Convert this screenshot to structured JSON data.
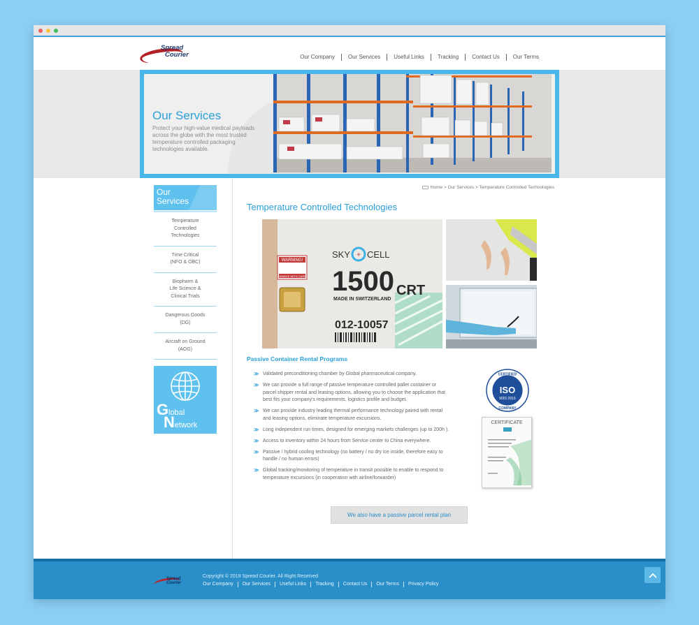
{
  "window": {
    "dots": [
      "#f25f5c",
      "#f9c23c",
      "#3fbf5b"
    ]
  },
  "header": {
    "logo_line1": "Spread",
    "logo_line2": "Courier",
    "nav": [
      "Our Company",
      "Our Services",
      "Useful Links",
      "Tracking",
      "Contact Us",
      "Our Terms"
    ]
  },
  "hero": {
    "title": "Our Services",
    "description": "Protect your high-value medical payloads across the globe with the most trusted temperature controlled packaging technologies available."
  },
  "sidebar": {
    "heading_line1": "Our",
    "heading_line2": "Services",
    "items": [
      {
        "lines": [
          "Temperature",
          "Controlled",
          "Technologies"
        ]
      },
      {
        "lines": [
          "Time Critical",
          "(NFO & OBC)"
        ]
      },
      {
        "lines": [
          "Biopharm &",
          "Life Science &",
          "Clinical Trials"
        ]
      },
      {
        "lines": [
          "Dangerous Goods",
          "(DG)"
        ]
      },
      {
        "lines": [
          "Aircraft on Ground",
          "(AOG)"
        ]
      }
    ],
    "global_network": {
      "g": "G",
      "lobal": "lobal",
      "n": "N",
      "etwork": "etwork"
    }
  },
  "breadcrumb": "Home > Our Services > Temperature Controlled Technologies",
  "main": {
    "title": "Temperature Controlled Technologies",
    "photo": {
      "brand_left": "SKY",
      "brand_right": "CELL",
      "model_number": "1500",
      "model_suffix": "CRT",
      "made_in": "MADE IN SWITZERLAND",
      "serial": "012-10057",
      "warning": "WARNING!",
      "handle_with_care": "HANDLE WITH CARE"
    },
    "section_title": "Passive Container Rental Programs",
    "bullets": [
      "Validated preconditioning chamber by Global pharmaceutical company.",
      "We can provide a full range of passive temperature controlled pallet container or parcel shipper rental and leasing options, allowing you to choose the application that best fits your company's requirements, logistics profile and budget.",
      "We can provide industry leading thermal performance technology paired with rental and leasing options, eliminate temperature excursions.",
      "Long independent run times, designed for emerging markets challenges (up to 200h ).",
      "Access to inventory within 24 hours from Service center to China everywhere.",
      "Passive / hybrid cooling technology (no battery / no dry ice inside, therefore easy to handle / no human errors)",
      "Global tracking/monitoring of temperature in transit possible to enable to respond to temperature excursions (in cooperation with airline/forwarder)"
    ],
    "iso": {
      "top": "CERTIFIED",
      "mark": "ISO",
      "standard": "9001:2015",
      "bottom": "COMPANY"
    },
    "certificate_label": "CERTIFICATE",
    "rental_button": "We also have a passive parcel rental plan"
  },
  "footer": {
    "logo_line1": "Spread",
    "logo_line2": "Courier",
    "copyright": "Copyright © 2019 Spread Courier. All Right Reserved",
    "links": [
      "Our Company",
      "Our Services",
      "Useful Links",
      "Tracking",
      "Contact Us",
      "Our Terms",
      "Privacy Policy"
    ]
  },
  "colors": {
    "accent": "#2aa0db",
    "footer": "#2a8fc9",
    "logo_red": "#b32025"
  }
}
